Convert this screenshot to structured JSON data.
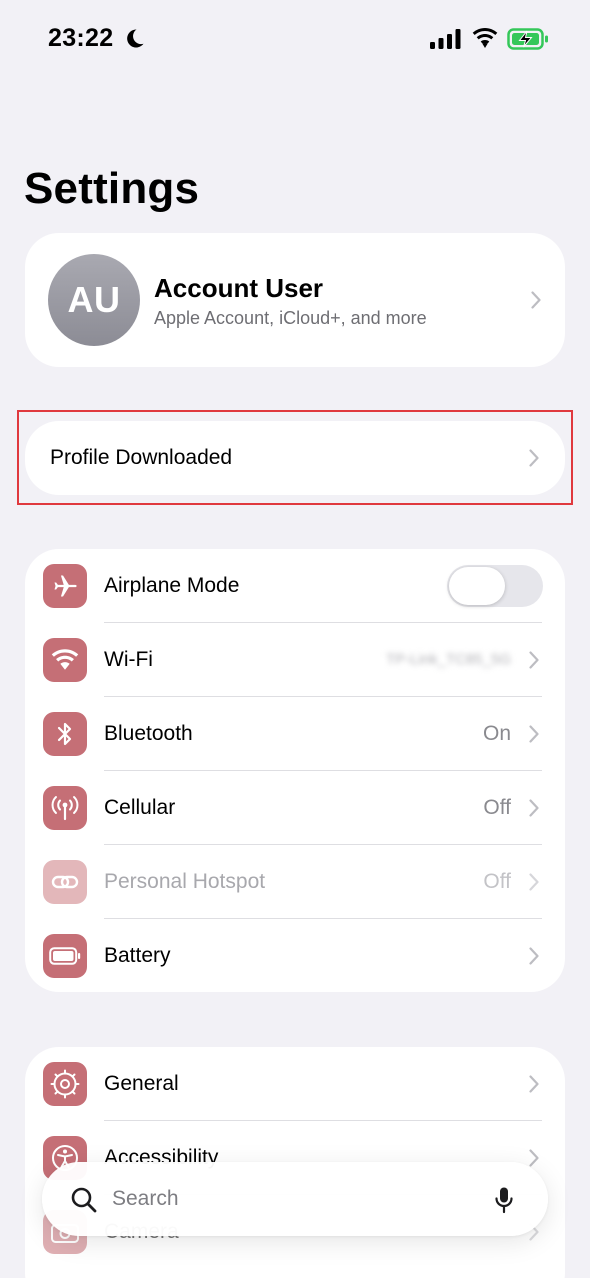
{
  "status_bar": {
    "time": "23:22"
  },
  "header": {
    "title": "Settings"
  },
  "account": {
    "initials": "AU",
    "name": "Account User",
    "subtitle": "Apple Account, iCloud+, and more"
  },
  "profile": {
    "label": "Profile Downloaded"
  },
  "network_group": [
    {
      "label": "Airplane Mode",
      "icon": "airplane-icon",
      "toggle_on": false
    },
    {
      "label": "Wi-Fi",
      "icon": "wifi-icon",
      "value": "TP-Link_TC85_5G"
    },
    {
      "label": "Bluetooth",
      "icon": "bluetooth-icon",
      "value": "On"
    },
    {
      "label": "Cellular",
      "icon": "antenna-icon",
      "value": "Off"
    },
    {
      "label": "Personal Hotspot",
      "icon": "link-icon",
      "value": "Off"
    },
    {
      "label": "Battery",
      "icon": "battery-icon"
    }
  ],
  "general_group": [
    {
      "label": "General",
      "icon": "gear-icon"
    },
    {
      "label": "Accessibility",
      "icon": "accessibility-icon"
    },
    {
      "label": "Camera",
      "icon": "camera-icon"
    }
  ],
  "search": {
    "placeholder": "Search"
  },
  "colors": {
    "background": "#f2f1f6",
    "icon_accent": "#c56f76",
    "highlight_border": "#e0393e",
    "battery_fill": "#34c759"
  }
}
